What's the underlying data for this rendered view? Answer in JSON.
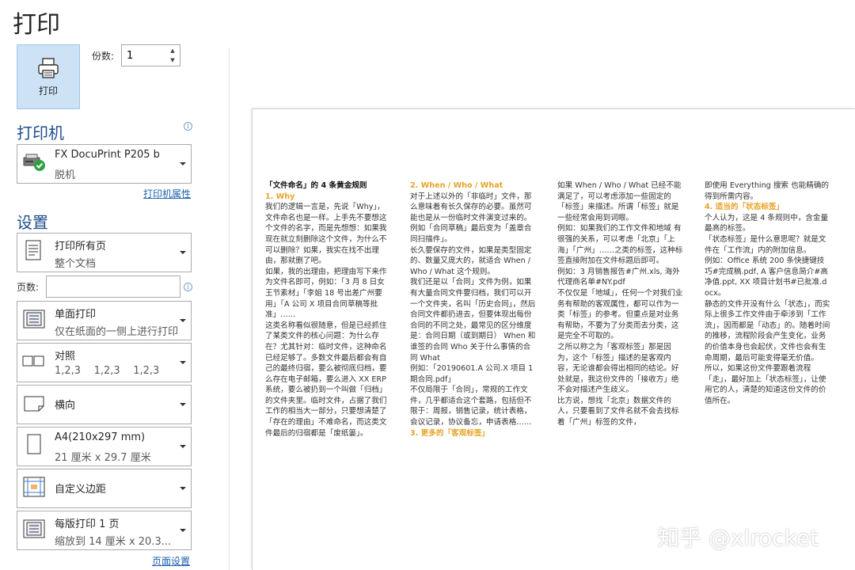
{
  "header": {
    "title": "打印"
  },
  "print_button": {
    "label": "打印"
  },
  "copies": {
    "label": "份数:",
    "value": "1"
  },
  "printer": {
    "heading": "打印机",
    "name": "FX DocuPrint P205 b",
    "status": "脱机",
    "properties_link": "打印机属性"
  },
  "settings": {
    "heading": "设置",
    "print_range": {
      "title": "打印所有页",
      "subtitle": "整个文档"
    },
    "pages_label": "页数:",
    "pages_value": "",
    "sides": {
      "title": "单面打印",
      "subtitle": "仅在纸面的一侧上进行打印"
    },
    "collate": {
      "title": "对照",
      "subtitle": "1,2,3    1,2,3    1,2,3"
    },
    "orientation": {
      "title": "横向"
    },
    "paper": {
      "title": "A4(210x297 mm)",
      "subtitle": "21 厘米 x 29.7 厘米"
    },
    "margins": {
      "title": "自定义边距"
    },
    "per_sheet": {
      "title": "每版打印 1 页",
      "subtitle": "缩放到 14 厘米 x 20.3..."
    },
    "page_setup_link": "页面设置"
  },
  "preview": {
    "col1": [
      {
        "c": "h",
        "t": "「文件命名」的 4 条黄金规则"
      },
      {
        "c": "y",
        "t": "1.  Why"
      },
      {
        "t": "我们的逻辑一言是，先说「Why」，文件命名也是一样。上手先不要想这个文件的名字，而是先想想：如果我现在就立刻删除这个文件，"
      },
      {
        "c": "b",
        "t": "为什么不可以删除？"
      },
      {
        "t": "如果，我实在找不出理由，那就删了吧。"
      },
      {
        "t": "如果，我的出理由，把理由写下来作为文件名即可，例如：「3 月 8 日女王节素材」「李姐 18 号出差广州要用」「A 公司 X 项目合同草稿等批准」……"
      },
      {
        "t": "这类名称看似很随意，但是已经抓住了某类文件的核心问题："
      },
      {
        "c": "b",
        "t": "为什么存在？"
      },
      {
        "t": "尤其针对："
      },
      {
        "c": "b",
        "t": "临时文件"
      },
      {
        "t": "，这种命名已经足够了。多数文件最后都会有自己的最终归宿，要么被彻底归档，要么存在电子邮箱，要么进入 XX ERP 系统，要么被扔到一个叫做「归档」的文件夹里。临时文件，占据了我们工作的相当大一部分，只要想清楚了「存在的理由」不难命名，而这类文件最后的归宿都是「废纸篓」。"
      }
    ],
    "col2": [
      {
        "c": "y",
        "t": "2. When / Who / What"
      },
      {
        "t": "对于上述以外的「非临时」文件，那么意味着有长久保存的必要。虽然可能也是从一份临时文件演变过来的。例如「合同草稿」最后变为「盖章合同扫描件」。"
      },
      {
        "t": "长久要保存的文件，如果是类型固定的、数量又庞大的，就适合 When / Who / What 这个规则。"
      },
      {
        "t": "我们还是以「合同」文件为例，如果有大量合同文件要归档，我们可以开一个文件夹，名叫「历史合同」，然后合同文件都扔进去，但要体现出每份合同的不同之处，最常见的区分维度是：合同日期（或到期日）  When 和谁签的合同  Who 关于什么事情的合同  What"
      },
      {
        "t": "例如：「20190601.A 公司.X 项目 1 期合同.pdf」"
      },
      {
        "t": "不仅局限于「合同」，常规的工作文件，几乎都适合这个套路，包括但不限于：周报，销售记录，统计表格，会议记录，协议备忘，申请表格……"
      },
      {
        "c": "y",
        "t": "3. 更多的「客观标签」"
      }
    ],
    "col3": [
      {
        "t": "如果 When / Who / What 已经不能满足了，可以考虑添加一些固定的「标签」来描述。所谓「标签」就是一些经常会用到词眼。"
      },
      {
        "t": "例如：如果我们的工作文件和地域 有很强的关系，可以考虑「北京」「上海」「广州」……之类的标签，这种标签直接附加在文件标题后即可。"
      },
      {
        "t": "例如：3 月销售报告#广州.xls, 海外代理商名单#NY.pdf"
      },
      {
        "t": "不仅仅是「地域」，任何一个对我们业务有帮助的客观属性，都可以作为一类「标签」的参考。但重点是对业务有帮助，"
      },
      {
        "c": "b",
        "t": "不要为了分类而去分类"
      },
      {
        "t": "，这是完全不可取的。"
      },
      {
        "t": "之所以称之为「客观标签」那是因为，这个「标签」描述的是客观内容，无论谁都会得出相同的结论。好处就是，我这份文件的「接收方」绝不会对描述产生歧义。"
      },
      {
        "t": "比方说，想找「北京」数据文件的人，只要看到了文件名就不会去找标着「广州」标签的文件，"
      }
    ],
    "col4": [
      {
        "t": "即使用 Everything 搜索 也能精确的得到所需内容。"
      },
      {
        "c": "y",
        "t": "4. 适当的「状态标签」"
      },
      {
        "t": "个人认为，这是 4 条规则中，含金量最高的标签。"
      },
      {
        "t": "「状态标签」是什么意思呢？就是文件在「工作流」内的附加信息。"
      },
      {
        "t": "例如：Office 系统 200 条快捷键技巧#完成稿.pdf, A 客户信息简介#高净值.ppt, XX 项目计划书#已批准.docx。"
      },
      {
        "t": "静态的文件开没有什么「状态」，而实际上很多工作文件由于牵涉到「工作流」，因而都是「动态」的。随着时间的推移，流程阶段会产生变化，业务的价值本身也会起伏，文件也会有生命周期，最后可能变得毫无价值。"
      },
      {
        "t": "所以，如果这份文件要跟着流程「走」，最好加上「状态标签」，让使用它的人，清楚的知道这份文件的价值所在。"
      }
    ]
  },
  "watermark": "知乎 @xlrocket"
}
